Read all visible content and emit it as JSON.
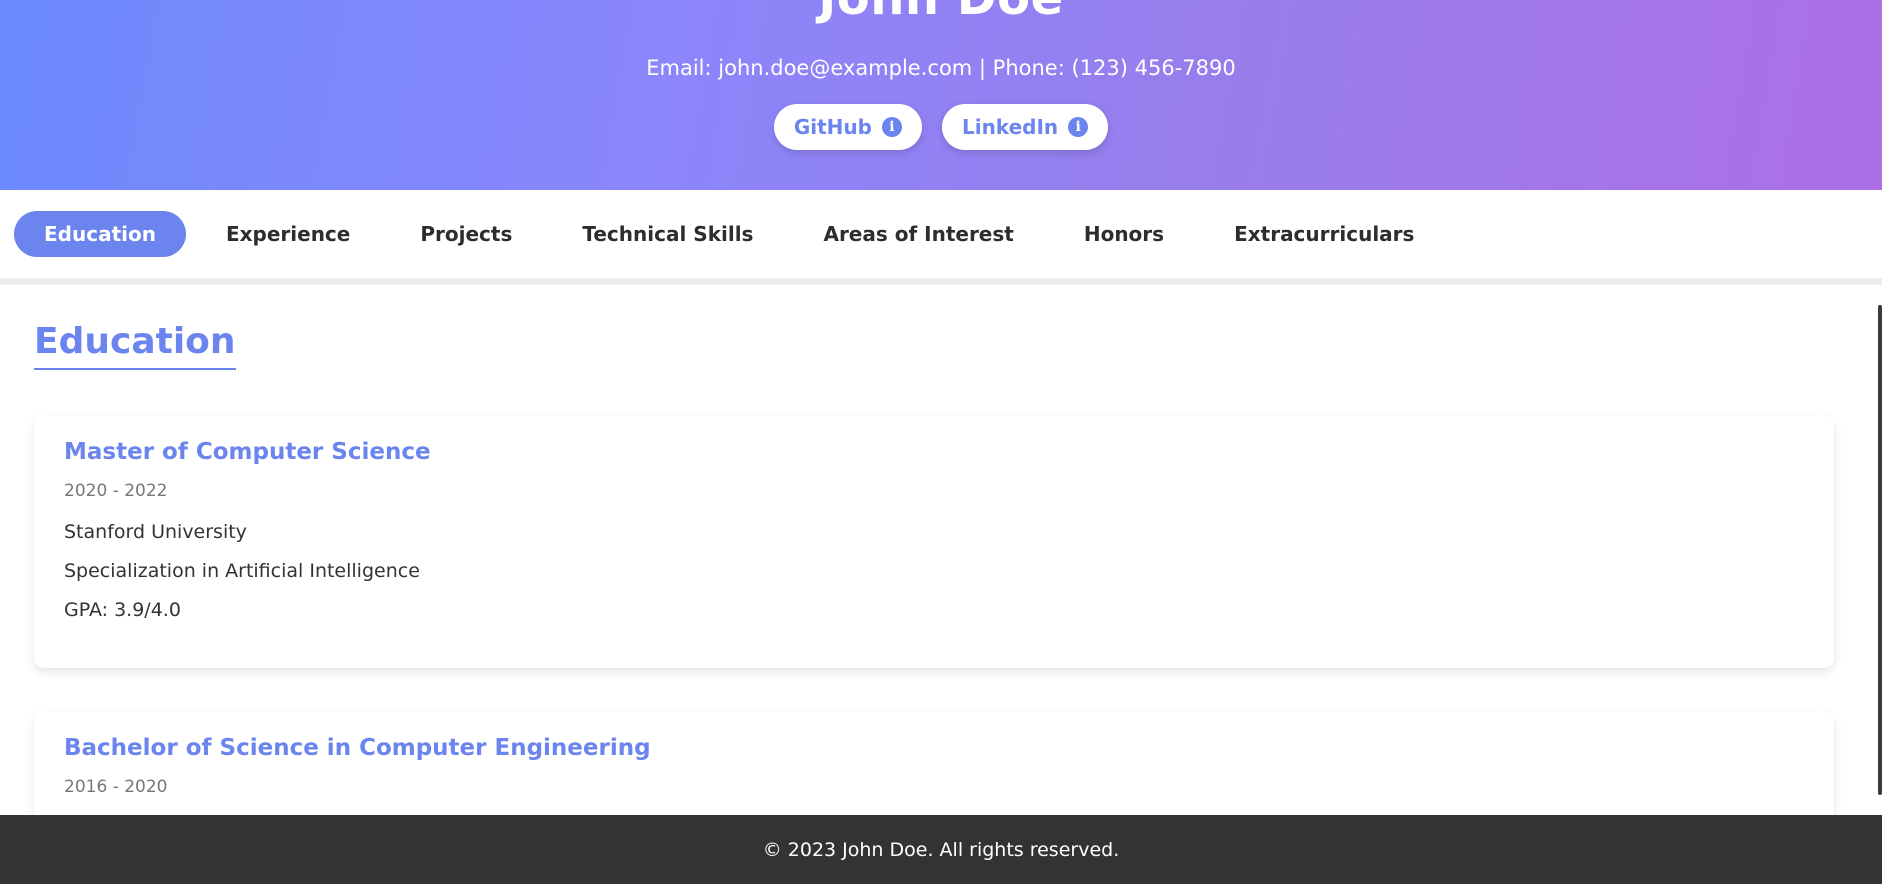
{
  "header": {
    "name": "John Doe",
    "contact": "Email: john.doe@example.com | Phone: (123) 456-7890",
    "links": [
      {
        "label": "GitHub",
        "icon": "info-icon"
      },
      {
        "label": "LinkedIn",
        "icon": "info-icon"
      }
    ]
  },
  "nav": {
    "tabs": [
      {
        "label": "Education",
        "active": true
      },
      {
        "label": "Experience",
        "active": false
      },
      {
        "label": "Projects",
        "active": false
      },
      {
        "label": "Technical Skills",
        "active": false
      },
      {
        "label": "Areas of Interest",
        "active": false
      },
      {
        "label": "Honors",
        "active": false
      },
      {
        "label": "Extracurriculars",
        "active": false
      }
    ]
  },
  "main": {
    "section_title": "Education",
    "entries": [
      {
        "degree": "Master of Computer Science",
        "dates": "2020 - 2022",
        "school": "Stanford University",
        "detail": "Specialization in Artificial Intelligence",
        "gpa": "GPA: 3.9/4.0"
      },
      {
        "degree": "Bachelor of Science in Computer Engineering",
        "dates": "2016 - 2020"
      }
    ]
  },
  "footer": {
    "text": "© 2023 John Doe. All rights reserved."
  },
  "colors": {
    "accent": "#6b84ee",
    "footer_bg": "#333333"
  }
}
